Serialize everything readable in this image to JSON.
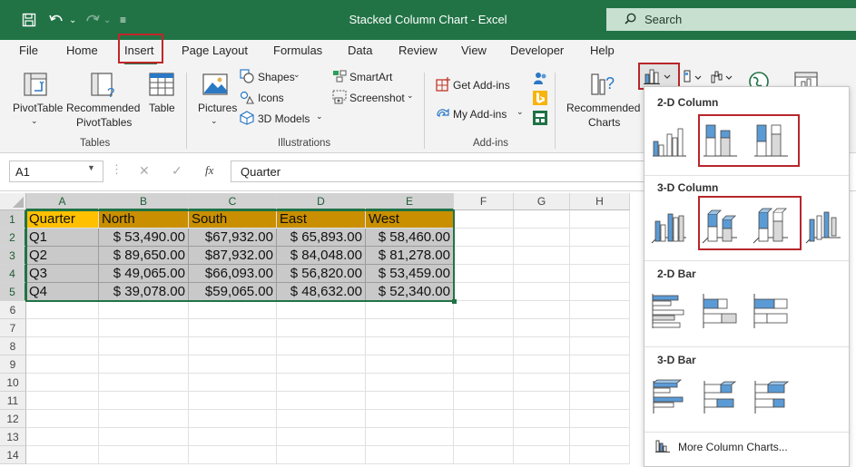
{
  "window": {
    "title": "Stacked Column Chart  -  Excel",
    "search_label": "Search"
  },
  "tabs": [
    {
      "label": "File"
    },
    {
      "label": "Home"
    },
    {
      "label": "Insert"
    },
    {
      "label": "Page Layout"
    },
    {
      "label": "Formulas"
    },
    {
      "label": "Data"
    },
    {
      "label": "Review"
    },
    {
      "label": "View"
    },
    {
      "label": "Developer"
    },
    {
      "label": "Help"
    }
  ],
  "ribbon": {
    "tables": {
      "group_label": "Tables",
      "pivottable": "PivotTable",
      "recommended_line1": "Recommended",
      "recommended_line2": "PivotTables",
      "table": "Table"
    },
    "illustrations": {
      "group_label": "Illustrations",
      "pictures": "Pictures",
      "shapes": "Shapes",
      "icons": "Icons",
      "models_3d": "3D Models",
      "smartart": "SmartArt",
      "screenshot": "Screenshot"
    },
    "addins": {
      "group_label": "Add-ins",
      "get_addins": "Get Add-ins",
      "my_addins": "My Add-ins"
    },
    "charts": {
      "recommended_line1": "Recommended",
      "recommended_line2": "Charts"
    }
  },
  "formula_bar": {
    "name_box": "A1",
    "fx": "fx",
    "value": "Quarter"
  },
  "grid": {
    "columns": [
      "A",
      "B",
      "C",
      "D",
      "E",
      "F",
      "G",
      "H"
    ],
    "rows": [
      "1",
      "2",
      "3",
      "4",
      "5",
      "6",
      "7",
      "8",
      "9",
      "10",
      "11",
      "12",
      "13",
      "14"
    ],
    "header": [
      "Quarter",
      "North",
      "South",
      "East",
      "West"
    ],
    "data": [
      [
        "Q1",
        "$ 53,490.00",
        "$67,932.00",
        "$ 65,893.00",
        "$ 58,460.00"
      ],
      [
        "Q2",
        "$ 89,650.00",
        "$87,932.00",
        "$ 84,048.00",
        "$ 81,278.00"
      ],
      [
        "Q3",
        "$ 49,065.00",
        "$66,093.00",
        "$ 56,820.00",
        "$ 53,459.00"
      ],
      [
        "Q4",
        "$ 39,078.00",
        "$59,065.00",
        "$ 48,632.00",
        "$ 52,340.00"
      ]
    ]
  },
  "chart_dropdown": {
    "section_2d_column": "2-D Column",
    "section_3d_column": "3-D Column",
    "section_2d_bar": "2-D Bar",
    "section_3d_bar": "3-D Bar",
    "more_link": "More Column Charts..."
  },
  "colors": {
    "excel_green": "#217346",
    "header_orange": "#c98f00",
    "header_yellow": "#ffc000",
    "data_gray": "#c9c9c9",
    "highlight_red": "#b7262b",
    "chart_blue": "#5b9bd5"
  }
}
